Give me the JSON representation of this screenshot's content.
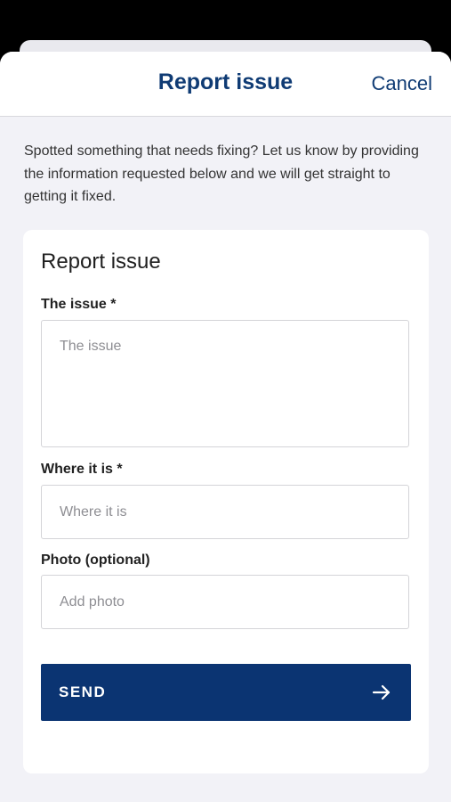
{
  "header": {
    "title": "Report issue",
    "cancel_label": "Cancel"
  },
  "intro_text": "Spotted something that needs fixing? Let us know by providing the information requested below and we will get straight to getting it fixed.",
  "form": {
    "title": "Report issue",
    "issue": {
      "label": "The issue *",
      "placeholder": "The issue",
      "value": ""
    },
    "location": {
      "label": "Where it is *",
      "placeholder": "Where it is",
      "value": ""
    },
    "photo": {
      "label": "Photo (optional)",
      "placeholder": "Add photo",
      "value": ""
    },
    "send_label": "SEND",
    "send_icon": "arrow-right-icon"
  },
  "colors": {
    "brand": "#0b3472",
    "title_text": "#0f3b74",
    "background": "#f2f2f7"
  }
}
